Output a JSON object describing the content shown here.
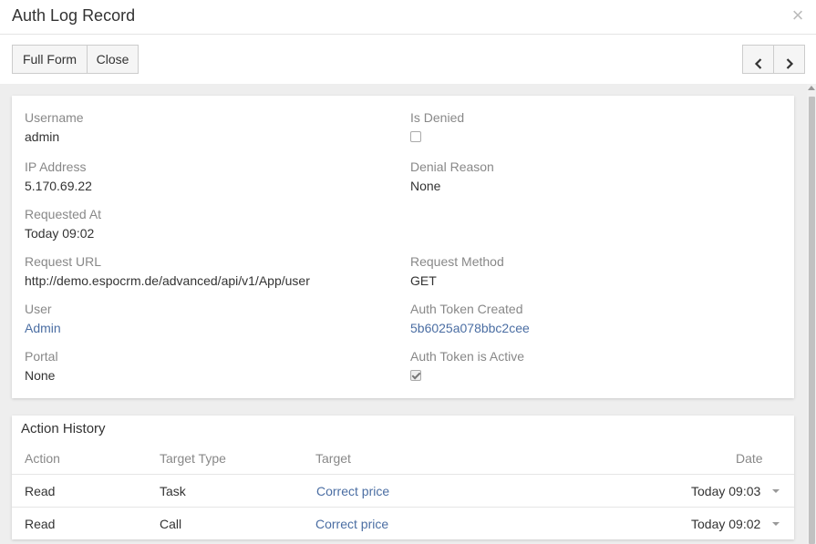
{
  "header": {
    "title": "Auth Log Record",
    "close_icon": "close-icon"
  },
  "toolbar": {
    "full_form_label": "Full Form",
    "close_label": "Close",
    "prev_icon": "chevron-left-icon",
    "next_icon": "chevron-right-icon"
  },
  "fields": {
    "username": {
      "label": "Username",
      "value": "admin"
    },
    "is_denied": {
      "label": "Is Denied",
      "checked": false
    },
    "ip_address": {
      "label": "IP Address",
      "value": "5.170.69.22"
    },
    "denial_reason": {
      "label": "Denial Reason",
      "value": "None"
    },
    "requested_at": {
      "label": "Requested At",
      "value": "Today 09:02"
    },
    "request_url": {
      "label": "Request URL",
      "value": "http://demo.espocrm.de/advanced/api/v1/App/user"
    },
    "request_method": {
      "label": "Request Method",
      "value": "GET"
    },
    "user": {
      "label": "User",
      "value": "Admin"
    },
    "auth_token_created": {
      "label": "Auth Token Created",
      "value": "5b6025a078bbc2cee"
    },
    "portal": {
      "label": "Portal",
      "value": "None"
    },
    "auth_token_active": {
      "label": "Auth Token is Active",
      "checked": true
    }
  },
  "history": {
    "title": "Action History",
    "columns": {
      "action": "Action",
      "target_type": "Target Type",
      "target": "Target",
      "date": "Date"
    },
    "rows": [
      {
        "action": "Read",
        "target_type": "Task",
        "target": "Correct price",
        "date": "Today 09:03"
      },
      {
        "action": "Read",
        "target_type": "Call",
        "target": "Correct price",
        "date": "Today 09:02"
      }
    ]
  },
  "colors": {
    "link": "#4b6ea3",
    "label": "#888888",
    "background": "#eeeeee"
  }
}
